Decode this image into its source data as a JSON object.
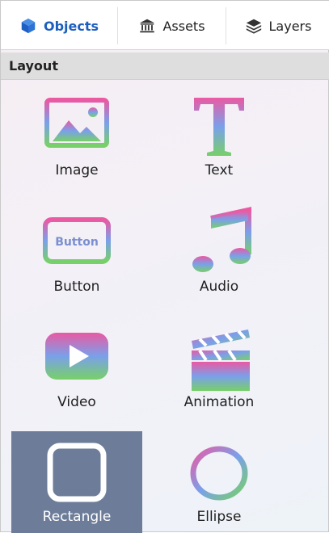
{
  "tabs": [
    {
      "label": "Objects",
      "icon": "cube-icon",
      "active": true
    },
    {
      "label": "Assets",
      "icon": "bank-icon",
      "active": false
    },
    {
      "label": "Layers",
      "icon": "layers-icon",
      "active": false
    }
  ],
  "section": {
    "title": "Layout"
  },
  "items": [
    {
      "label": "Image",
      "icon": "image-icon"
    },
    {
      "label": "Text",
      "icon": "text-icon"
    },
    {
      "label": "Button",
      "icon": "button-icon",
      "icon_text": "Button"
    },
    {
      "label": "Audio",
      "icon": "music-note-icon"
    },
    {
      "label": "Video",
      "icon": "play-icon"
    },
    {
      "label": "Animation",
      "icon": "clapperboard-icon"
    },
    {
      "label": "Rectangle",
      "icon": "rectangle-icon",
      "selected": true
    },
    {
      "label": "Ellipse",
      "icon": "ellipse-icon"
    }
  ],
  "colors": {
    "accent": "#1d5fbf",
    "selected_bg": "#6d7d99",
    "gradient": [
      "#e85fa6",
      "#6fa7ea",
      "#7cd36a"
    ]
  }
}
